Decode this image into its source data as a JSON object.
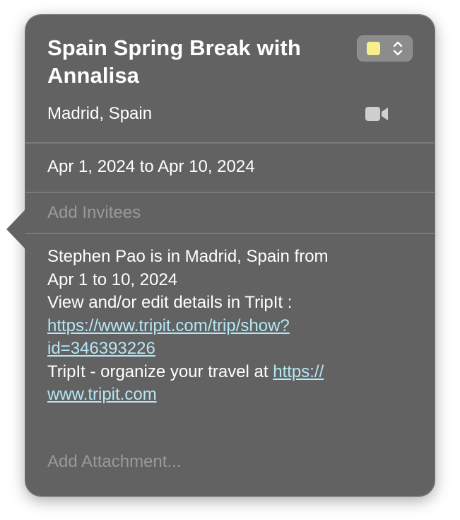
{
  "event": {
    "title": "Spain Spring Break with Annalisa",
    "location": "Madrid, Spain",
    "date_range": "Apr 1, 2024 to Apr 10, 2024",
    "invitees_placeholder": "Add Invitees",
    "attachment_label": "Add Attachment..."
  },
  "calendar_color": {
    "swatch": "#f7ef8c",
    "icon": "up-down-chevron-icon"
  },
  "video_call_icon": "video-camera-icon",
  "notes": {
    "line1": "Stephen Pao is in Madrid, Spain from",
    "line2": "Apr 1 to 10, 2024",
    "line3": "View and/or edit details in TripIt :",
    "link1_part1": "https://www.tripit.com/trip/show?",
    "link1_part2": "id=346393226",
    "line6_text": "TripIt - organize your travel at ",
    "link2_part1": "https://",
    "link2_part2": "www.tripit.com"
  },
  "colors": {
    "panel_background": "#626262",
    "link": "#b5e6f4",
    "placeholder_text": "#9a9a9a",
    "primary_text": "#ffffff"
  }
}
